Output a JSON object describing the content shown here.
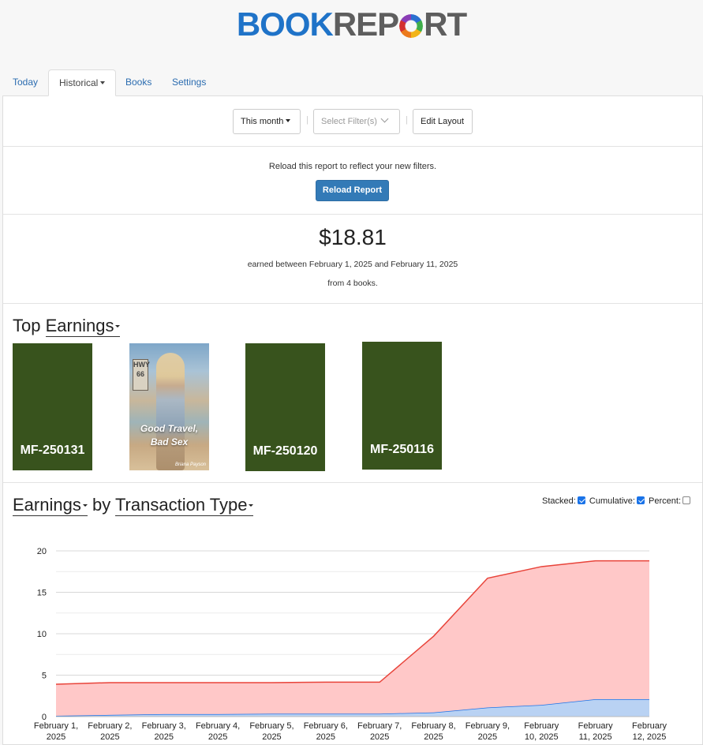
{
  "logo": {
    "part1": "BOOK",
    "part2a": "REP",
    "part2b": "RT"
  },
  "tabs": [
    {
      "label": "Today"
    },
    {
      "label": "Historical"
    },
    {
      "label": "Books"
    },
    {
      "label": "Settings"
    }
  ],
  "toolbar": {
    "period": "This month",
    "filter_placeholder": "Select Filter(s)",
    "edit_layout": "Edit Layout",
    "separator": "|"
  },
  "reload": {
    "message": "Reload this report to reflect your new filters.",
    "button": "Reload Report"
  },
  "summary": {
    "amount": "$18.81",
    "line1": "earned between February 1, 2025 and February 11, 2025",
    "line2": "from 4 books."
  },
  "top_earnings": {
    "heading_prefix": "Top",
    "heading_link": "Earnings",
    "books": [
      {
        "code": "MF-250131",
        "color": "#38531d"
      },
      {
        "title_line1": "Good Travel,",
        "title_line2": "Bad Sex",
        "author": "Briana Payson",
        "sign": "HWY 66"
      },
      {
        "code": "MF-250120",
        "color": "#38531d"
      },
      {
        "code": "MF-250116",
        "color": "#38531d"
      }
    ]
  },
  "earnings_chart": {
    "heading_link1": "Earnings",
    "heading_mid": "by",
    "heading_link2": "Transaction Type",
    "options": {
      "stacked_label": "Stacked:",
      "stacked": true,
      "cumulative_label": "Cumulative:",
      "cumulative": true,
      "percent_label": "Percent:",
      "percent": false
    }
  },
  "chart_data": {
    "type": "area",
    "stacked": true,
    "categories": [
      [
        "February 1,",
        "2025"
      ],
      [
        "February 2,",
        "2025"
      ],
      [
        "February 3,",
        "2025"
      ],
      [
        "February 4,",
        "2025"
      ],
      [
        "February 5,",
        "2025"
      ],
      [
        "February 6,",
        "2025"
      ],
      [
        "February 7,",
        "2025"
      ],
      [
        "February 8,",
        "2025"
      ],
      [
        "February 9,",
        "2025"
      ],
      [
        "February",
        "10, 2025"
      ],
      [
        "February",
        "11, 2025"
      ],
      [
        "February",
        "12, 2025"
      ]
    ],
    "ylim": [
      0,
      20
    ],
    "yticks": [
      "0",
      "5",
      "10",
      "15",
      "20"
    ],
    "grid": true,
    "series": [
      {
        "values": [
          0.1,
          0.2,
          0.3,
          0.3,
          0.35,
          0.35,
          0.35,
          0.5,
          1.1,
          1.4,
          2.1,
          2.1
        ],
        "color": "#1a73e8",
        "fill": "#b9d2f3"
      },
      {
        "values": [
          3.8,
          3.9,
          3.8,
          3.8,
          3.75,
          3.8,
          3.8,
          9.2,
          15.6,
          16.7,
          16.7,
          16.7
        ],
        "color": "#e8443a",
        "fill": "#ffc8c8"
      }
    ]
  }
}
